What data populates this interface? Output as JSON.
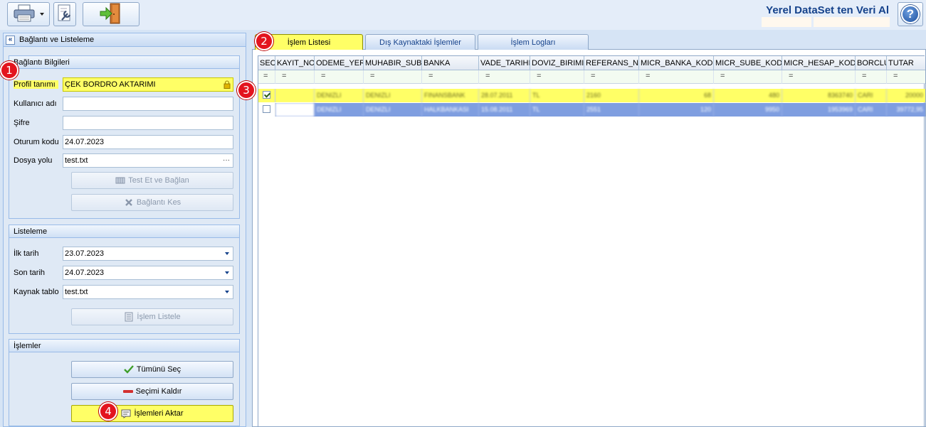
{
  "app_title": "Yerel DataSet ten Veri Al",
  "toolbar": {
    "help_symbol": "?"
  },
  "left_panel": {
    "title": "Bağlantı ve Listeleme",
    "collapse_symbol": "«",
    "connection": {
      "title": "Bağlantı Bilgileri",
      "profile_label": "Profil tanımı",
      "profile_value": "ÇEK BORDRO AKTARIMI",
      "username_label": "Kullanıcı adı",
      "username_value": "",
      "password_label": "Şifre",
      "password_value": "",
      "session_label": "Oturum kodu",
      "session_value": "24.07.2023",
      "filepath_label": "Dosya yolu",
      "filepath_value": "test.txt",
      "filepath_ellipsis": "···",
      "test_button": "Test Et ve Bağlan",
      "disconnect_button": "Bağlantı Kes"
    },
    "listing": {
      "title": "Listeleme",
      "first_date_label": "İlk tarih",
      "first_date_value": "23.07.2023",
      "last_date_label": "Son tarih",
      "last_date_value": "24.07.2023",
      "source_label": "Kaynak tablo",
      "source_value": "test.txt",
      "list_button": "İşlem Listele"
    },
    "operations": {
      "title": "İşlemler",
      "select_all_button": "Tümünü Seç",
      "clear_button": "Seçimi Kaldır",
      "transfer_button": "İşlemleri Aktar"
    }
  },
  "tabs": [
    {
      "label": "İşlem Listesi"
    },
    {
      "label": "Dış Kaynaktaki İşlemler"
    },
    {
      "label": "İşlem Logları"
    }
  ],
  "grid": {
    "columns": [
      "SEC",
      "KAYIT_NO",
      "ODEME_YERI",
      "MUHABIR_SUBE",
      "BANKA",
      "VADE_TARIHI",
      "DOVIZ_BIRIMI",
      "REFERANS_NO",
      "MICR_BANKA_KODU",
      "MICR_SUBE_KODU",
      "MICR_HESAP_KODU",
      "BORCLU",
      "TUTAR"
    ],
    "filter_symbol": "=",
    "rows": [
      {
        "checked": true,
        "cells": [
          "",
          "DENIZLI",
          "DENIZLI",
          "FINANSBANK",
          "28.07.2011",
          "TL",
          "2160",
          "68",
          "480",
          "8363740",
          "CARI",
          "20000"
        ]
      },
      {
        "checked": false,
        "cells": [
          "",
          "DENIZLI",
          "DENIZLI",
          "HALKBANKASI",
          "15.08.2011",
          "TL",
          "2551",
          "120",
          "9950",
          "1953969",
          "CARI",
          "39772,95"
        ]
      }
    ]
  },
  "badges": [
    "1",
    "2",
    "3",
    "4"
  ],
  "colors": {
    "highlight": "#ffff66",
    "selected_row": "#7f9ee0",
    "badge": "#e3141e",
    "title": "#15428b"
  }
}
